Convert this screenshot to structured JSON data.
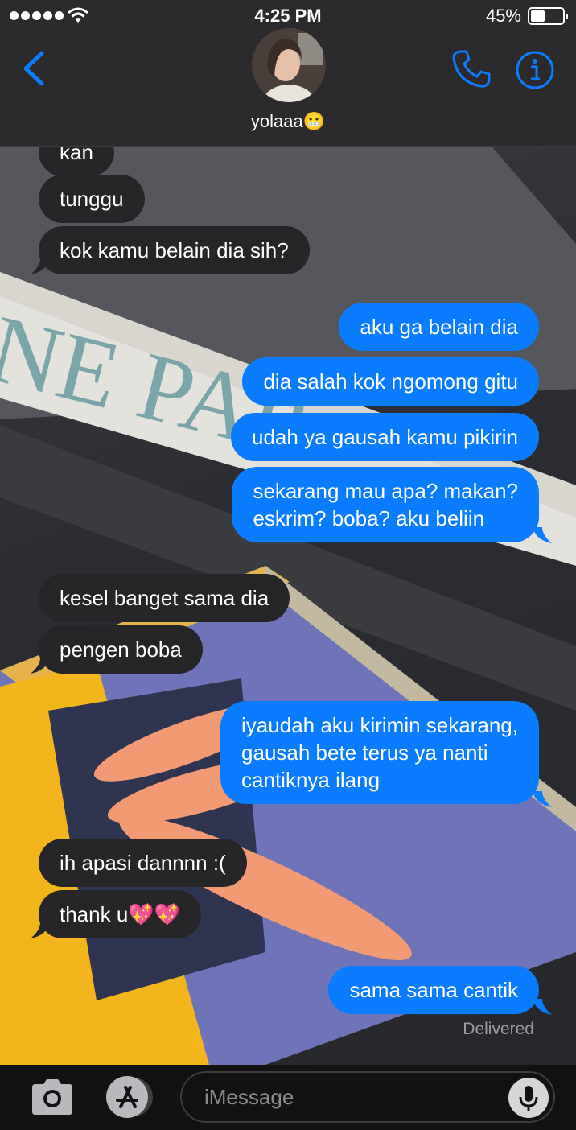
{
  "status_bar": {
    "time": "4:25 PM",
    "battery_percent": "45%",
    "battery_level": 0.45,
    "signal_bars": 5,
    "wifi_icon": "wifi-icon"
  },
  "header": {
    "contact_name": "yolaaa😬",
    "back_icon": "chevron-left-icon",
    "call_icon": "phone-icon",
    "info_icon": "info-icon"
  },
  "colors": {
    "accent": "#0a7cff",
    "incoming_bubble": "#262628",
    "header_bg": "#2b2b2d"
  },
  "messages": [
    {
      "direction": "in",
      "text": "kan"
    },
    {
      "direction": "in",
      "text": "tunggu"
    },
    {
      "direction": "in",
      "text": "kok kamu belain dia sih?"
    },
    {
      "direction": "out",
      "text": "aku ga belain dia"
    },
    {
      "direction": "out",
      "text": "dia salah kok ngomong gitu"
    },
    {
      "direction": "out",
      "text": "udah ya gausah kamu pikirin"
    },
    {
      "direction": "out",
      "text": "sekarang mau apa? makan?\neskrim? boba? aku beliin"
    },
    {
      "direction": "in",
      "text": "kesel banget sama dia"
    },
    {
      "direction": "in",
      "text": "pengen boba"
    },
    {
      "direction": "out",
      "text": "iyaudah aku kirimin sekarang,\ngausah bete terus ya nanti\ncantiknya ilang"
    },
    {
      "direction": "in",
      "text": "ih apasi dannnn :("
    },
    {
      "direction": "in",
      "text": "thank u💖💖"
    },
    {
      "direction": "out",
      "text": "sama sama cantik"
    }
  ],
  "delivery_status": "Delivered",
  "wallpaper_text": "NE PAP",
  "input_bar": {
    "placeholder": "iMessage",
    "camera_icon": "camera-icon",
    "appstore_icon": "app-store-icon",
    "mic_icon": "microphone-icon"
  }
}
